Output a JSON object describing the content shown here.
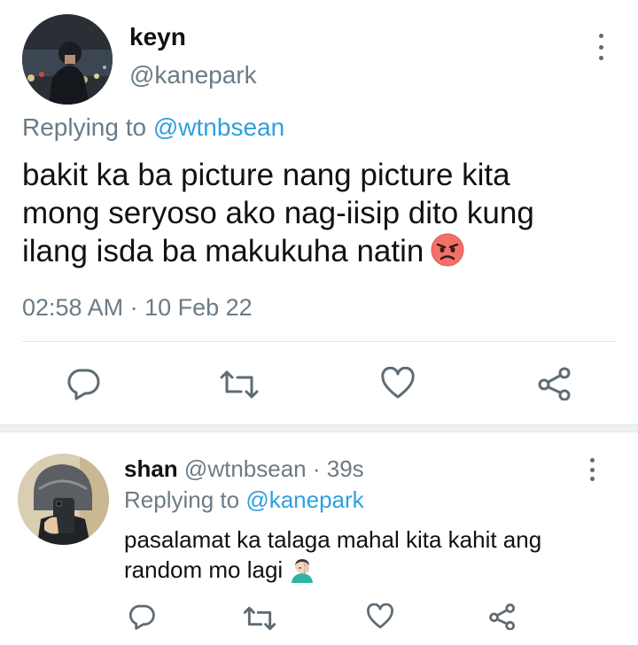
{
  "tweet": {
    "display_name": "keyn",
    "handle": "@kanepark",
    "replying_prefix": "Replying to",
    "replying_to": "@wtnbsean",
    "text_line1": "bakit ka ba picture nang picture kita",
    "text_line2": "mong seryoso ako nag-iisip dito kung",
    "text_line3": "ilang isda ba makukuha natin",
    "emoji": "angry-face-emoji",
    "timestamp": "02:58 AM · 10 Feb 22"
  },
  "reply": {
    "display_name": "shan",
    "handle": "@wtnbsean",
    "time_sep": "·",
    "time": "39s",
    "replying_prefix": "Replying to",
    "replying_to": "@kanepark",
    "text_line1": "pasalamat ka talaga mahal kita kahit ang",
    "text_line2": "random mo lagi",
    "emoji": "face-palm-emoji"
  },
  "actions": [
    "reply-icon",
    "retweet-icon",
    "like-icon",
    "share-icon"
  ],
  "colors": {
    "link": "#2f9fe0",
    "secondary_text": "#6b7b86",
    "icon": "#5f6b73"
  }
}
